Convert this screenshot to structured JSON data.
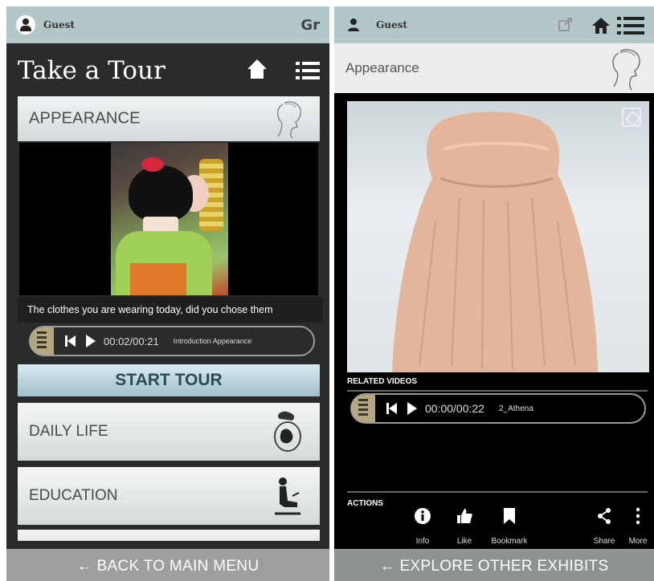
{
  "left": {
    "user": "Guest",
    "lang": "Gr",
    "title": "Take a Tour",
    "section": "APPEARANCE",
    "caption": "The clothes you are wearing today, did you chose them",
    "player": {
      "time": "00:02/00:21",
      "track": "Introduction Appearance"
    },
    "start": "START TOUR",
    "categories": [
      {
        "label": "DAILY LIFE"
      },
      {
        "label": "EDUCATION"
      }
    ],
    "back": "← BACK TO MAIN MENU"
  },
  "right": {
    "user": "Guest",
    "section": "Appearance",
    "related_label": "RELATED VIDEOS",
    "player": {
      "time": "00:00/00:22",
      "track": "2_Athena"
    },
    "actions_label": "ACTIONS",
    "actions": [
      {
        "label": "Info",
        "icon": "info-icon"
      },
      {
        "label": "Like",
        "icon": "like-icon"
      },
      {
        "label": "Bookmark",
        "icon": "bookmark-icon"
      },
      {
        "label": "Share",
        "icon": "share-icon"
      },
      {
        "label": "More",
        "icon": "more-icon"
      }
    ],
    "explore": "← EXPLORE OTHER EXHIBITS"
  },
  "colors": {
    "topbar": "#b3c7c8",
    "start_tour": "#9fc0cb",
    "dark_bg": "#2b2b2b",
    "bottom_bar": "#9c9e9f"
  }
}
